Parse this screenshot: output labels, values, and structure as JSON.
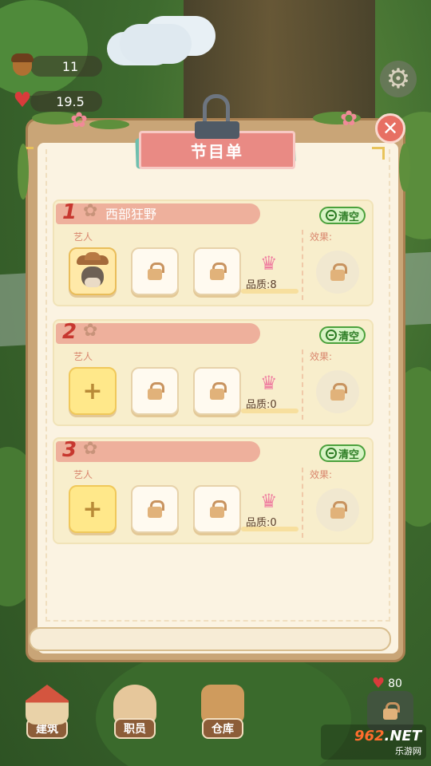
{
  "hud": {
    "acorns": "11",
    "hearts": "19.5"
  },
  "modal": {
    "title": "节目单",
    "close_label": "✕"
  },
  "programs": [
    {
      "index": "1",
      "name": "西部狂野",
      "clear_label": "清空",
      "artist_label": "艺人",
      "effect_label": "效果:",
      "quality": "品质:8",
      "slots": [
        "artist",
        "locked",
        "locked"
      ]
    },
    {
      "index": "2",
      "name": "",
      "clear_label": "清空",
      "artist_label": "艺人",
      "effect_label": "效果:",
      "quality": "品质:0",
      "slots": [
        "add",
        "locked",
        "locked"
      ]
    },
    {
      "index": "3",
      "name": "",
      "clear_label": "清空",
      "artist_label": "艺人",
      "effect_label": "效果:",
      "quality": "品质:0",
      "slots": [
        "add",
        "locked",
        "locked"
      ]
    }
  ],
  "nav": {
    "building": "建筑",
    "staff": "职员",
    "warehouse": "仓库"
  },
  "right_hud": {
    "hearts": "80"
  },
  "watermark": {
    "brand_number": "962",
    "brand_suffix": ".NET",
    "subtitle": "乐游网"
  },
  "icons": {
    "add": "+",
    "gear": "⚙",
    "star": "✿",
    "crown": "♛",
    "heart": "♥"
  },
  "colors": {
    "title_ribbon": "#e98a84",
    "clear_green": "#4ba13c",
    "card_bg": "#f8eecc",
    "close_red": "#e76f63"
  }
}
